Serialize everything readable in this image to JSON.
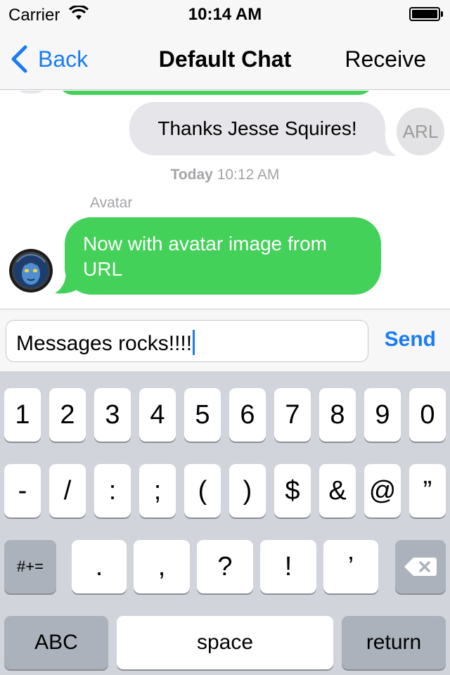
{
  "status_bar": {
    "carrier": "Carrier",
    "time": "10:14 AM"
  },
  "nav": {
    "back_label": "Back",
    "title": "Default Chat",
    "receive_label": "Receive"
  },
  "messages": {
    "outgoing_text": "Thanks Jesse Squires!",
    "outgoing_avatar_initials": "ARL",
    "timestamp_day": "Today",
    "timestamp_time": "10:12 AM",
    "incoming_sender": "Avatar",
    "incoming_text": "Now with avatar image from URL"
  },
  "toolbar": {
    "input_value": "Messages rocks!!!!",
    "send_label": "Send"
  },
  "keyboard": {
    "row1": [
      "1",
      "2",
      "3",
      "4",
      "5",
      "6",
      "7",
      "8",
      "9",
      "0"
    ],
    "row2": [
      "-",
      "/",
      ":",
      ";",
      "(",
      ")",
      "$",
      "&",
      "@",
      "”"
    ],
    "row3_mode": "#+=",
    "row3": [
      ".",
      ",",
      "?",
      "!",
      "’"
    ],
    "abc_label": "ABC",
    "space_label": "space",
    "return_label": "return"
  },
  "colors": {
    "accent": "#1a7cf5",
    "bubble_green": "#43d159",
    "bubble_gray": "#e5e5ea",
    "keyboard_bg": "#d1d5db"
  }
}
